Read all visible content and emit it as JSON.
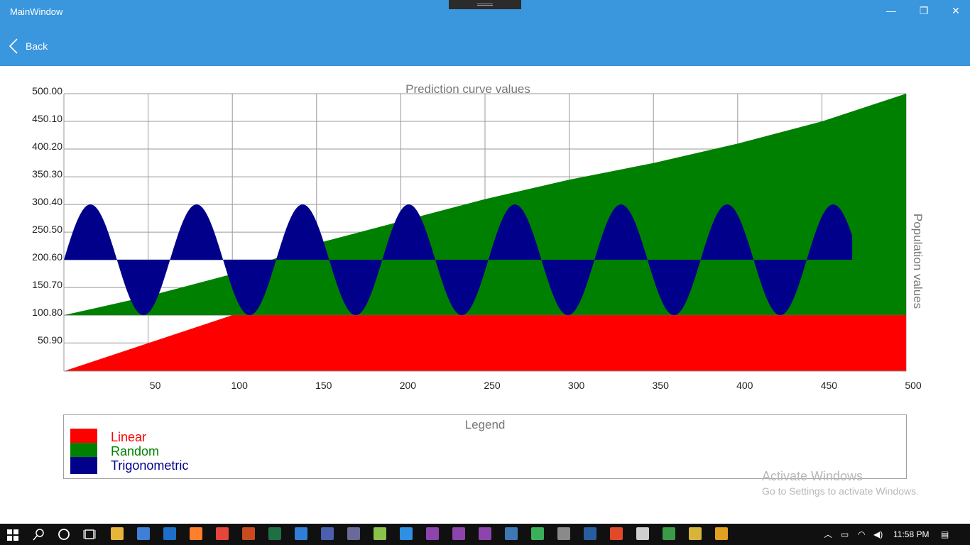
{
  "window": {
    "title": "MainWindow",
    "minimize_glyph": "—",
    "maximize_glyph": "❐",
    "close_glyph": "✕",
    "back_label": "Back",
    "accent": "#3a96dd"
  },
  "chart_data": {
    "type": "area",
    "title": "Prediction curve values",
    "ylabel": "Population values",
    "xlabel": "",
    "xlim": [
      0,
      500
    ],
    "ylim": [
      0,
      500
    ],
    "x_ticks": [
      "50",
      "100",
      "150",
      "200",
      "250",
      "300",
      "350",
      "400",
      "450",
      "500"
    ],
    "y_ticks": [
      "50.90",
      "100.80",
      "150.70",
      "200.60",
      "250.50",
      "300.40",
      "350.30",
      "400.20",
      "450.10",
      "500.00"
    ],
    "grid": true,
    "series": [
      {
        "name": "Random",
        "color": "#008000",
        "x": [
          0,
          50,
          100,
          150,
          200,
          250,
          300,
          350,
          400,
          450,
          500
        ],
        "y": [
          100.8,
          135,
          175,
          230,
          270,
          310,
          345,
          375,
          410,
          450,
          500
        ]
      },
      {
        "name": "Trigonometric",
        "color": "#00008b",
        "baseline": 200.6,
        "amplitude": 99.8,
        "period": 63,
        "x_start": 0,
        "x_end": 468
      },
      {
        "name": "Linear",
        "color": "#ff0000",
        "x": [
          0,
          100,
          500
        ],
        "y": [
          0,
          100.8,
          100.8
        ]
      }
    ],
    "legend": {
      "title": "Legend",
      "position": "bottom",
      "items": [
        {
          "name": "Linear",
          "color": "#ff0000"
        },
        {
          "name": "Random",
          "color": "#008000"
        },
        {
          "name": "Trigonometric",
          "color": "#00008b"
        }
      ]
    }
  },
  "watermark": {
    "line1": "Activate Windows",
    "line2": "Go to Settings to activate Windows."
  },
  "taskbar": {
    "time": "11:58 PM",
    "icons": [
      "windows-start-icon",
      "search-icon",
      "cortana-icon",
      "task-view-icon",
      "file-explorer-icon",
      "store-icon",
      "mail-icon",
      "firefox-icon",
      "chrome-icon",
      "app-icon",
      "excel-icon",
      "edge-icon",
      "app-icon",
      "app-icon",
      "android-studio-icon",
      "vscode-icon",
      "visual-studio-icon",
      "visual-studio-icon",
      "visual-studio-icon",
      "python-icon",
      "app-icon",
      "app-icon",
      "powershell-icon",
      "app-icon",
      "virtualbox-icon",
      "app-icon",
      "app-icon",
      "app-icon",
      "app-icon"
    ]
  }
}
